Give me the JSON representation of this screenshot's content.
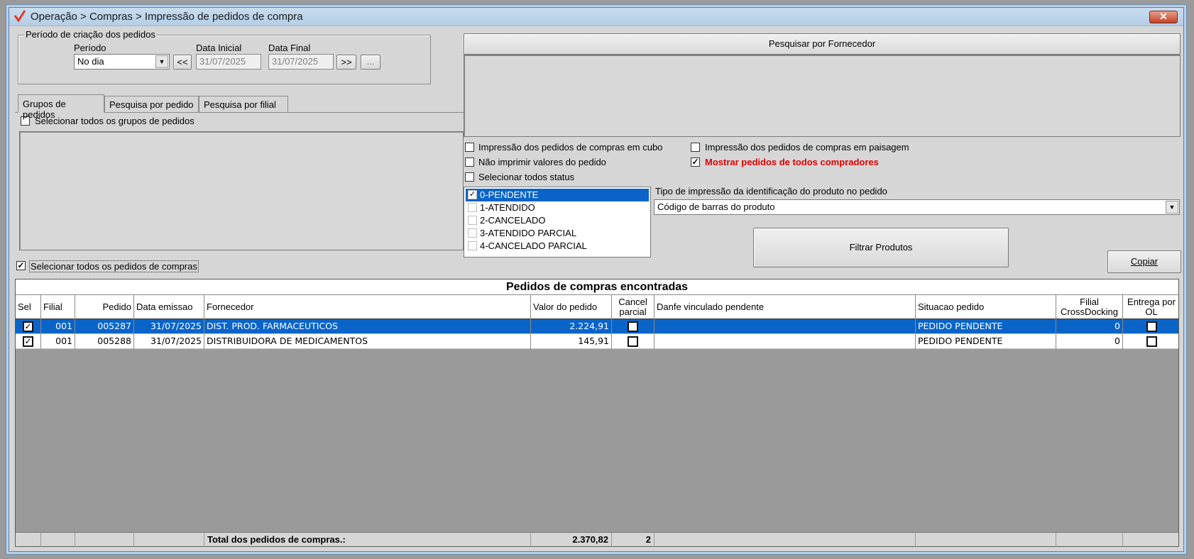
{
  "window": {
    "title": "Operação > Compras > Impressão de pedidos de compra",
    "close_label": "✕"
  },
  "periodo_group": {
    "title": "Período de criação dos pedidos",
    "periodo_label": "Período",
    "periodo_value": "No dia",
    "data_inicial_label": "Data Inicial",
    "data_inicial_value": "31/07/2025",
    "data_final_label": "Data Final",
    "data_final_value": "31/07/2025",
    "prev_label": "<<",
    "next_label": ">>",
    "more_label": "..."
  },
  "tabs": [
    "Grupos de pedidos",
    "Pesquisa por pedido",
    "Pesquisa por filial"
  ],
  "grupos": {
    "select_all_label": "Selecionar todos os grupos de pedidos",
    "select_all_checked": false
  },
  "select_all_pedidos": {
    "label": "Selecionar todos os pedidos de compras",
    "checked": true
  },
  "fornecedor": {
    "button_label": "Pesquisar por Fornecedor"
  },
  "options": {
    "cubo": "Impressão dos pedidos de compras em cubo",
    "paisagem": "Impressão dos pedidos de compras em paisagem",
    "nao_imprimir": "Não imprimir valores do pedido",
    "mostrar_todos": "Mostrar pedidos de todos compradores",
    "selecionar_status": "Selecionar todos status"
  },
  "status_list": [
    {
      "label": "0-PENDENTE",
      "checked": true,
      "selected": true
    },
    {
      "label": "1-ATENDIDO",
      "checked": false,
      "selected": false
    },
    {
      "label": "2-CANCELADO",
      "checked": false,
      "selected": false
    },
    {
      "label": "3-ATENDIDO PARCIAL",
      "checked": false,
      "selected": false
    },
    {
      "label": "4-CANCELADO PARCIAL",
      "checked": false,
      "selected": false
    }
  ],
  "tipo_impressao": {
    "label": "Tipo de impressão da identificação do produto no pedido",
    "value": "Código de barras do produto"
  },
  "filtrar_label": "Filtrar Produtos",
  "copiar_label": "Copiar",
  "grid": {
    "caption": "Pedidos de compras encontradas",
    "headers": [
      "Sel",
      "Filial",
      "Pedido",
      "Data emissao",
      "Fornecedor",
      "Valor do pedido",
      "Cancel parcial",
      "Danfe vinculado pendente",
      "Situacao pedido",
      "Filial CrossDocking",
      "Entrega por OL"
    ],
    "rows": [
      {
        "sel": true,
        "filial": "001",
        "pedido": "005287",
        "data": "31/07/2025",
        "fornecedor": "DIST. PROD. FARMACEUTICOS",
        "valor": "2.224,91",
        "cancel": false,
        "danfe": "",
        "situacao": "PEDIDO PENDENTE",
        "cross": "0",
        "entrega": false
      },
      {
        "sel": true,
        "filial": "001",
        "pedido": "005288",
        "data": "31/07/2025",
        "fornecedor": "DISTRIBUIDORA DE MEDICAMENTOS",
        "valor": "145,91",
        "cancel": false,
        "danfe": "",
        "situacao": "PEDIDO PENDENTE",
        "cross": "0",
        "entrega": false
      }
    ],
    "footer": {
      "label": "Total dos pedidos de compras.:",
      "total": "2.370,82",
      "count": "2"
    }
  },
  "colors": {
    "accent": "#0a64c8",
    "warning_text": "#e00000"
  }
}
